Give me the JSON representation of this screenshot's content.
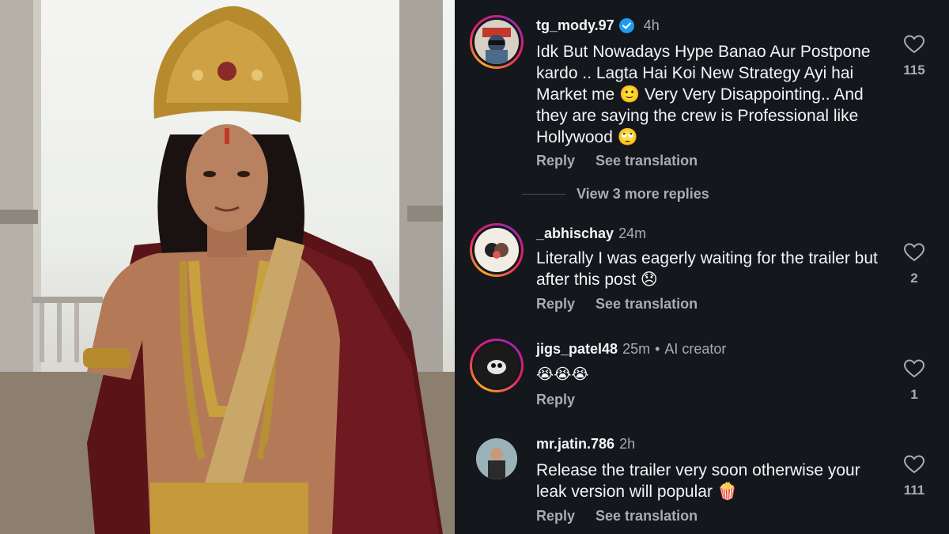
{
  "comments": [
    {
      "username": "tg_mody.97",
      "verified": true,
      "time": "4h",
      "text": "Idk But Nowadays Hype Banao Aur Postpone kardo .. Lagta Hai Koi New Strategy Ayi hai Market me 🙂 Very Very Disappointing.. And they are saying the crew is Professional like Hollywood 🙄",
      "reply_label": "Reply",
      "translate_label": "See translation",
      "likes": "115",
      "view_more": "View 3 more replies"
    },
    {
      "username": "_abhischay",
      "time": "24m",
      "text": "Literally I was eagerly waiting for the trailer but after this post 😞",
      "reply_label": "Reply",
      "translate_label": "See translation",
      "likes": "2"
    },
    {
      "username": "jigs_patel48",
      "time": "25m",
      "creator_label": "AI creator",
      "text": "😭😭😭",
      "reply_label": "Reply",
      "likes": "1"
    },
    {
      "username": "mr.jatin.786",
      "time": "2h",
      "text": "Release the trailer very soon otherwise your leak version will popular 🍿",
      "reply_label": "Reply",
      "translate_label": "See translation",
      "likes": "111"
    }
  ],
  "icons": {
    "like": "heart-outline-icon",
    "verified": "verified-badge-icon"
  },
  "colors": {
    "background": "#14171c",
    "text": "#f3f5f7",
    "muted": "#a8adb3",
    "verified": "#1d9bf0",
    "story_ring": [
      "#f9a825",
      "#e91e63",
      "#9c27b0"
    ]
  }
}
